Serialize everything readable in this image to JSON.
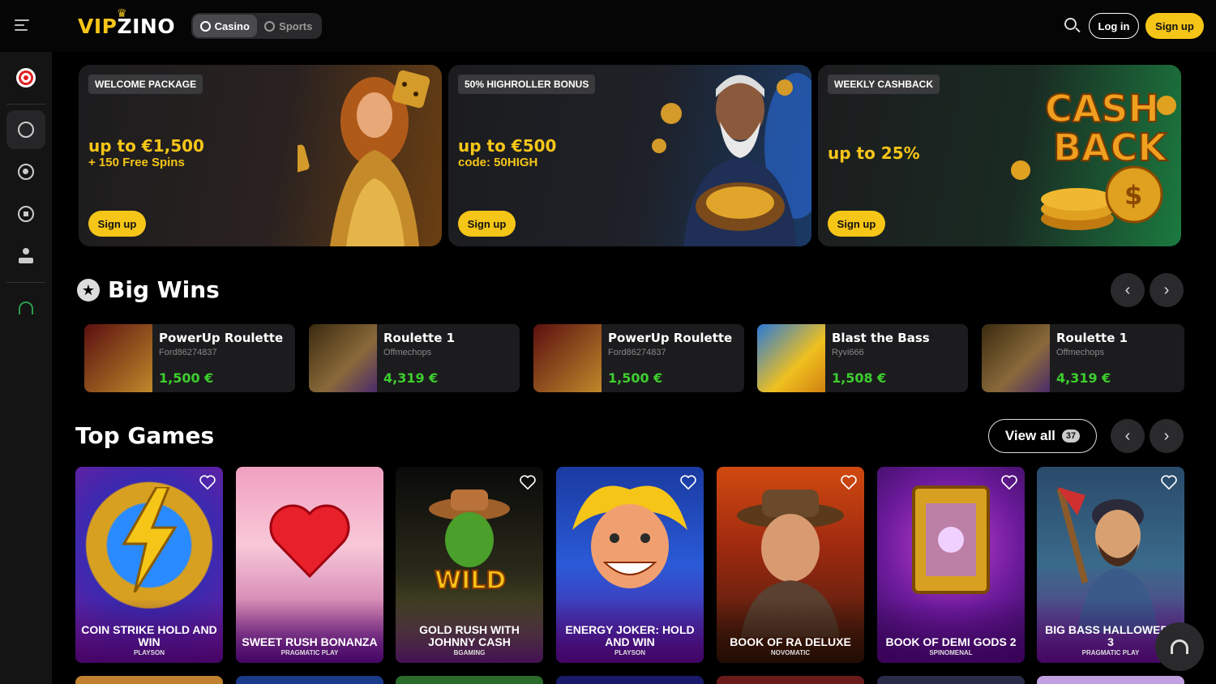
{
  "header": {
    "logo_vip": "VIP",
    "logo_zino": "ZINO",
    "switch": [
      {
        "label": "Casino",
        "active": true
      },
      {
        "label": "Sports",
        "active": false
      }
    ],
    "login_label": "Log in",
    "signup_label": "Sign up",
    "icons": {
      "menu": "hamburger-menu-icon",
      "search": "search-icon"
    }
  },
  "sidebar": {
    "items": [
      {
        "name": "dart-target-icon"
      },
      {
        "name": "casino-chip-icon",
        "active": true
      },
      {
        "name": "live-broadcast-icon"
      },
      {
        "name": "soccer-ball-icon"
      },
      {
        "name": "joystick-icon"
      },
      {
        "name": "headset-support-icon"
      }
    ]
  },
  "promos": [
    {
      "tag": "WELCOME PACKAGE",
      "amount": "up to €1,500",
      "sub": "+ 150 Free Spins",
      "cta": "Sign up",
      "art": "golden-woman-with-dice"
    },
    {
      "tag": "50% HIGHROLLER BONUS",
      "amount": "up to €500",
      "sub": "code: 50HIGH",
      "cta": "Sign up",
      "art": "old-sailor-with-coins"
    },
    {
      "tag": "WEEKLY CASHBACK",
      "amount": "up to 25%",
      "sub": "",
      "cta": "Sign up",
      "art": "cash-back-coins"
    }
  ],
  "big_wins": {
    "title": "Big Wins",
    "items": [
      {
        "game": "PowerUp Roulette",
        "user": "Ford86274837",
        "amount": "1,500 €"
      },
      {
        "game": "Roulette 1",
        "user": "Offmechops",
        "amount": "4,319 €"
      },
      {
        "game": "PowerUp Roulette",
        "user": "Ford86274837",
        "amount": "1,500 €"
      },
      {
        "game": "Blast the Bass",
        "user": "Ryvi666",
        "amount": "1,508 €"
      },
      {
        "game": "Roulette 1",
        "user": "Offmechops",
        "amount": "4,319 €"
      }
    ]
  },
  "top_games": {
    "title": "Top Games",
    "view_all_label": "View all",
    "view_all_count": "37",
    "games": [
      {
        "title": "COIN STRIKE HOLD AND WIN",
        "provider": "PLAYSON"
      },
      {
        "title": "SWEET RUSH BONANZA",
        "provider": "PRAGMATIC PLAY"
      },
      {
        "title": "GOLD RUSH WITH JOHNNY CASH",
        "provider": "BGAMING"
      },
      {
        "title": "ENERGY JOKER: HOLD AND WIN",
        "provider": "PLAYSON"
      },
      {
        "title": "BOOK OF RA DELUXE",
        "provider": "NOVOMATIC"
      },
      {
        "title": "BOOK OF DEMI GODS 2",
        "provider": "SPINOMENAL"
      },
      {
        "title": "BIG BASS HALLOWEEN 3",
        "provider": "PRAGMATIC PLAY"
      }
    ]
  },
  "colors": {
    "accent": "#f5c518",
    "win_green": "#3ccf2e",
    "background": "#000000",
    "sidebar": "#141414"
  }
}
